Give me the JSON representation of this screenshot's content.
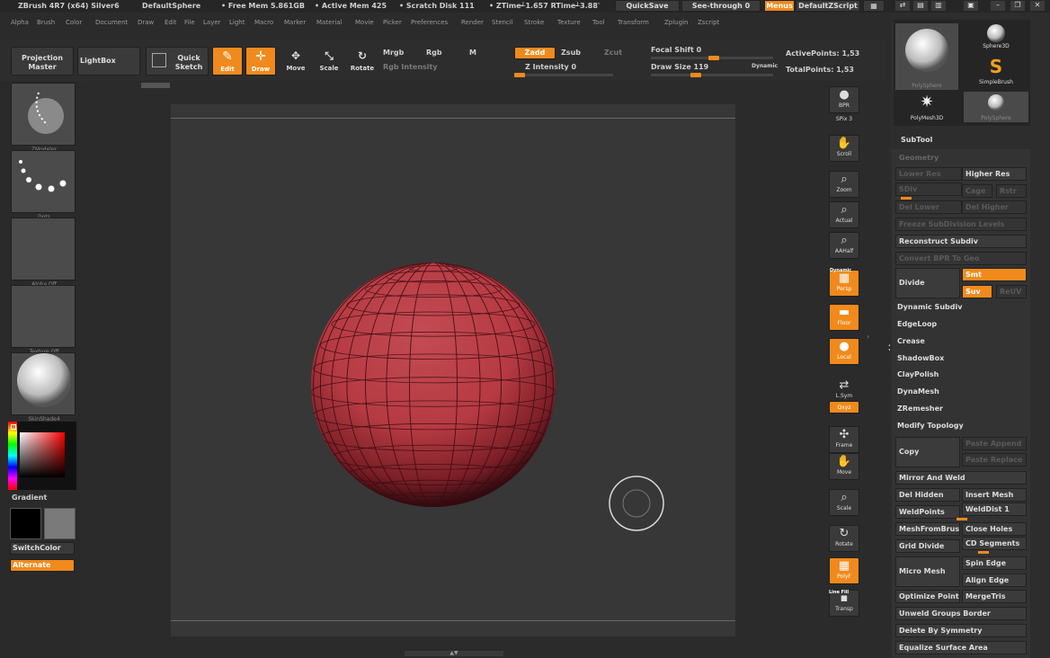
{
  "titlebar": {
    "app": "ZBrush 4R7 (x64) Silver6",
    "doc": "DefaultSphere",
    "free_mem": "• Free Mem 5.861GB",
    "active_mem": "• Active Mem 425",
    "scratch": "• Scratch Disk 111",
    "timing": "• ZTime┵1.657 RTime┵3.88‵",
    "quicksave": "QuickSave",
    "see_through": "See-through  0",
    "menus": "Menus",
    "zscript": "DefaultZScript"
  },
  "menubar": [
    "Alpha",
    "Brush",
    "Color",
    "Document",
    "Draw",
    "Edit",
    "File",
    "Layer",
    "Light",
    "Macro",
    "Marker",
    "Material",
    "Movie",
    "Picker",
    "Preferences",
    "Render",
    "Stencil",
    "Stroke",
    "Texture",
    "Tool",
    "Transform",
    "Zplugin",
    "Zscript"
  ],
  "toolbar": {
    "projection_master": "Projection Master",
    "lightbox": "LightBox",
    "quick_sketch": "Quick Sketch",
    "edit": "Edit",
    "draw": "Draw",
    "move": "Move",
    "scale": "Scale",
    "rotate": "Rotate",
    "mrgb": "Mrgb",
    "rgb": "Rgb",
    "m": "M",
    "rgb_intensity": "Rgb Intensity",
    "zadd": "Zadd",
    "zsub": "Zsub",
    "zcut": "Zcut",
    "z_intensity": "Z Intensity 0",
    "focal_shift": "Focal Shift 0",
    "draw_size": "Draw Size 119",
    "dynamic": "Dynamic",
    "active_points": "ActivePoints: 1,53",
    "total_points": "TotalPoints: 1,53"
  },
  "left": {
    "brush": "ZModeler",
    "stroke": "Dots",
    "alpha": "Alpha Off",
    "texture": "Texture Off",
    "material": "SkinShade4",
    "gradient": "Gradient",
    "switch_color": "SwitchColor",
    "alternate": "Alternate"
  },
  "shelf": [
    {
      "ic": "●",
      "t": "BPR"
    },
    {
      "ic": "",
      "t": "SPix 3"
    },
    {
      "ic": "✋",
      "t": "Scroll"
    },
    {
      "ic": "⌕",
      "t": "Zoom"
    },
    {
      "ic": "⌕",
      "t": "Actual"
    },
    {
      "ic": "⌕",
      "t": "AAHalf"
    },
    {
      "ic": "▦",
      "t": "Persp"
    },
    {
      "ic": "▬",
      "t": "Floor"
    },
    {
      "ic": "●",
      "t": "Local"
    },
    {
      "ic": "⇄",
      "t": "L.Sym"
    },
    {
      "ic": "",
      "t": "Qxyz"
    },
    {
      "ic": "✣",
      "t": "Frame"
    },
    {
      "ic": "✋",
      "t": "Move"
    },
    {
      "ic": "⌕",
      "t": "Scale"
    },
    {
      "ic": "↻",
      "t": "Rotate"
    },
    {
      "ic": "▦",
      "t": "PolyF"
    },
    {
      "ic": "▪",
      "t": "Transp"
    }
  ],
  "shelf_labels": {
    "dynamic": "Dynamic",
    "line_fill": "Line Fill"
  },
  "right": {
    "tools": [
      "PolySphere",
      "Sphere3D",
      "SimpleBrush",
      "PolyMesh3D",
      "PolySphere"
    ],
    "subtool": "SubTool",
    "geometry": "Geometry",
    "items": {
      "lower_res": "Lower Res",
      "higher_res": "Higher Res",
      "sdiv": "SDiv",
      "cage": "Cage",
      "rstr": "Rstr",
      "del_lower": "Del Lower",
      "del_higher": "Del Higher",
      "freeze": "Freeze SubDivision Levels",
      "reconstruct": "Reconstruct Subdiv",
      "convert_bpr": "Convert BPR To Geo",
      "divide": "Divide",
      "smt": "Smt",
      "suv": "Suv",
      "reuv": "ReUV",
      "dynamic_subdiv": "Dynamic Subdiv",
      "edgeloop": "EdgeLoop",
      "crease": "Crease",
      "shadowbox": "ShadowBox",
      "claypolish": "ClayPolish",
      "dynamesh": "DynaMesh",
      "zremesher": "ZRemesher",
      "modify_topology": "Modify Topology",
      "copy": "Copy",
      "paste_append": "Paste Append",
      "paste_replace": "Paste Replace",
      "mirror_weld": "Mirror And Weld",
      "del_hidden": "Del Hidden",
      "insert_mesh": "Insert Mesh",
      "weldpoints": "WeldPoints",
      "welddist": "WeldDist 1",
      "meshfrombrush": "MeshFromBrush",
      "close_holes": "Close Holes",
      "grid_divide": "Grid Divide",
      "cd_segments": "CD Segments",
      "micro_mesh": "Micro Mesh",
      "spin_edge": "Spin Edge",
      "align_edge": "Align Edge",
      "optimize_points": "Optimize Points",
      "mergetris": "MergeTris",
      "unweld_groups": "Unweld Groups Border",
      "delete_symmetry": "Delete By Symmetry",
      "equalize": "Equalize Surface Area"
    }
  },
  "colors": {
    "accent": "#f08a1c",
    "mesh": "#b53a42"
  }
}
